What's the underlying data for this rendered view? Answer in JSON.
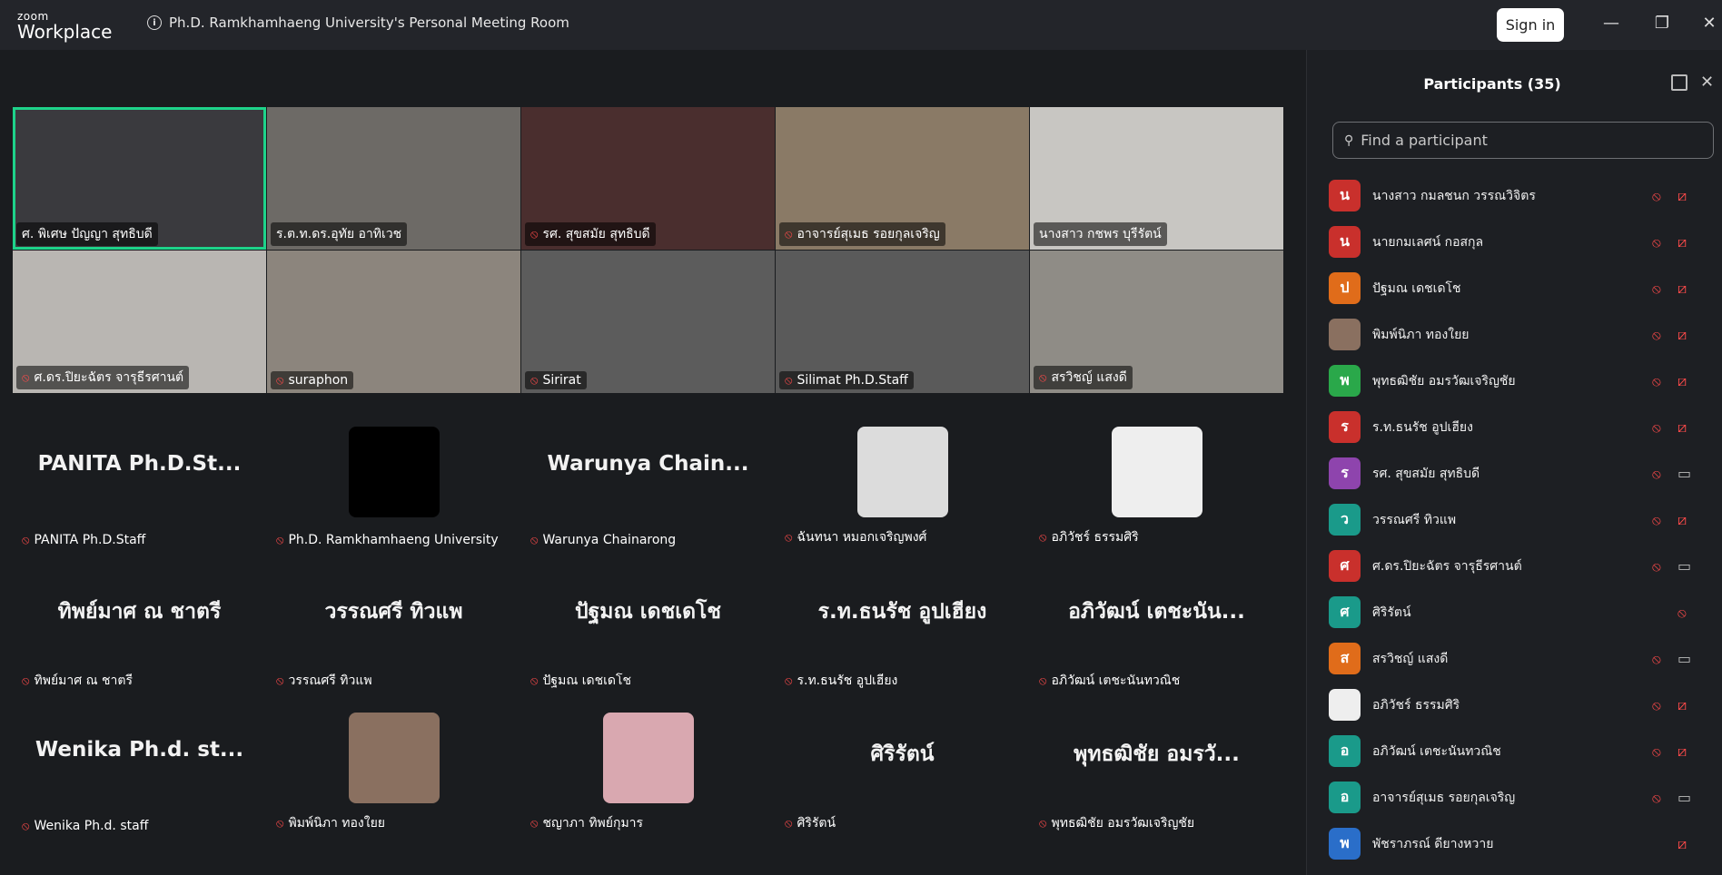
{
  "app": {
    "logo_small": "zoom",
    "logo_big": "Workplace",
    "meeting_title": "Ph.D. Ramkhamhaeng University's Personal Meeting Room",
    "signin": "Sign in"
  },
  "video_tiles": [
    {
      "name": "ศ. พิเศษ ปัญญา สุทธิบดี",
      "muted": false,
      "bg": "#3a3a3e"
    },
    {
      "name": "ร.ต.ท.ดร.อุทัย อาทิเวช",
      "muted": false,
      "bg": "#6d6a66"
    },
    {
      "name": "รศ. สุขสมัย สุทธิบดี",
      "muted": true,
      "bg": "#4a2e2e"
    },
    {
      "name": "อาจารย์สุเมธ รอยกุลเจริญ",
      "muted": true,
      "bg": "#8a7a66"
    },
    {
      "name": "นางสาว กชพร บุรีรัตน์",
      "muted": false,
      "bg": "#c8c6c2"
    },
    {
      "name": "ศ.ดร.ปิยะฉัตร จารุธีรศานต์",
      "muted": true,
      "bg": "#b9b6b2"
    },
    {
      "name": "suraphon",
      "muted": true,
      "bg": "#8c857d"
    },
    {
      "name": "Sirirat",
      "muted": true,
      "bg": "#5c5c5c"
    },
    {
      "name": "Silimat Ph.D.Staff",
      "muted": true,
      "bg": "#5a5a5a"
    },
    {
      "name": "สรวิชญ์ แสงดี",
      "muted": true,
      "bg": "#8f8c86"
    }
  ],
  "name_tiles": [
    {
      "big": "PANITA Ph.D.St...",
      "name": "PANITA Ph.D.Staff"
    },
    {
      "big": "",
      "name": "Ph.D. Ramkhamhaeng University",
      "avatar": "#000000"
    },
    {
      "big": "Warunya Chain...",
      "name": "Warunya Chainarong"
    },
    {
      "big": "",
      "name": "ฉันทนา หมอกเจริญพงศ์",
      "avatar": "#dcdcdc"
    },
    {
      "big": "",
      "name": "อภิวัชร์ ธรรมศิริ",
      "avatar": "#eeeeee"
    },
    {
      "big": "ทิพย์มาศ ณ ชาตรี",
      "name": "ทิพย์มาศ ณ ชาตรี"
    },
    {
      "big": "วรรณศรี ทิวแพ",
      "name": "วรรณศรี ทิวแพ"
    },
    {
      "big": "ปัฐมณ เดชเดโช",
      "name": "ปัฐมณ เดชเดโช"
    },
    {
      "big": "ร.ท.ธนรัช อูปเฮียง",
      "name": "ร.ท.ธนรัช อูปเฮียง"
    },
    {
      "big": "อภิวัฒน์ เตชะนัน...",
      "name": "อภิวัฒน์ เตชะนันทวณิช"
    },
    {
      "big": "Wenika Ph.d. st...",
      "name": "Wenika Ph.d. staff"
    },
    {
      "big": "",
      "name": "พิมพ์นิภา ทองใยย",
      "avatar": "#8a7060"
    },
    {
      "big": "",
      "name": "ชญาภา ทิพย์กุมาร",
      "avatar": "#d9a8b0"
    },
    {
      "big": "ศิริรัตน์",
      "name": "ศิริรัตน์"
    },
    {
      "big": "พุทธฒิชัย อมรวั...",
      "name": "พุทธฒิชัย อมรวัฒเจริญชัย"
    }
  ],
  "participants_panel": {
    "title": "Participants (35)",
    "search_placeholder": "Find a participant",
    "items": [
      {
        "initial": "น",
        "color": "#c9302c",
        "name": "นางสาว กมลชนก วรรณวิจิตร",
        "cam_on": false
      },
      {
        "initial": "น",
        "color": "#c9302c",
        "name": "นายกมเลศน์ กอสกุล",
        "cam_on": false
      },
      {
        "initial": "ป",
        "color": "#e06c1a",
        "name": "ปัฐมณ เดชเดโช",
        "cam_on": false
      },
      {
        "initial": "",
        "color": "#8a7060",
        "name": "พิมพ์นิภา ทองใยย",
        "cam_on": false
      },
      {
        "initial": "พ",
        "color": "#2aa84a",
        "name": "พุทธฒิชัย อมรวัฒเจริญชัย",
        "cam_on": false
      },
      {
        "initial": "ร",
        "color": "#c9302c",
        "name": "ร.ท.ธนรัช อูปเฮียง",
        "cam_on": false
      },
      {
        "initial": "ร",
        "color": "#8e44ad",
        "name": "รศ. สุขสมัย สุทธิบดี",
        "cam_on": true
      },
      {
        "initial": "ว",
        "color": "#1a9a8a",
        "name": "วรรณศรี ทิวแพ",
        "cam_on": false
      },
      {
        "initial": "ศ",
        "color": "#c9302c",
        "name": "ศ.ดร.ปิยะฉัตร จารุธีรศานต์",
        "cam_on": true
      },
      {
        "initial": "ศ",
        "color": "#1a9a8a",
        "name": "ศิริรัตน์",
        "cam_on": false,
        "no_cam": true
      },
      {
        "initial": "ส",
        "color": "#e06c1a",
        "name": "สรวิชญ์ แสงดี",
        "cam_on": true
      },
      {
        "initial": "",
        "color": "#eeeeee",
        "name": "อภิวัชร์ ธรรมศิริ",
        "cam_on": false
      },
      {
        "initial": "อ",
        "color": "#1a9a8a",
        "name": "อภิวัฒน์ เตชะนันทวณิช",
        "cam_on": false
      },
      {
        "initial": "อ",
        "color": "#1a9a8a",
        "name": "อาจารย์สุเมธ รอยกุลเจริญ",
        "cam_on": true
      },
      {
        "initial": "พ",
        "color": "#2a6ec9",
        "name": "พัชราภรณ์ ดียางหวาย",
        "cam_on": false,
        "no_mic": true
      }
    ]
  }
}
